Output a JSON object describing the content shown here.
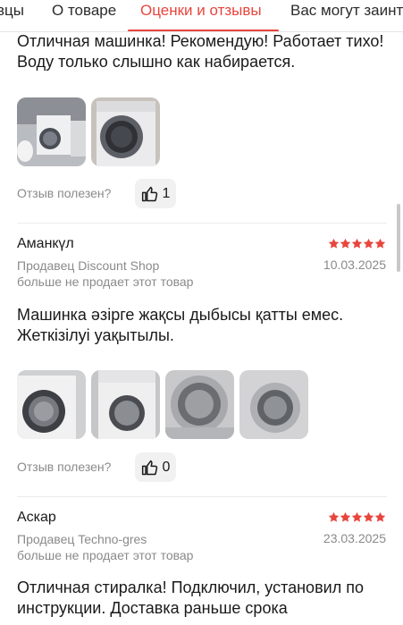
{
  "tabs": [
    {
      "label": "вцы"
    },
    {
      "label": "О товаре"
    },
    {
      "label": "Оценки и отзывы"
    },
    {
      "label": "Вас могут заинт"
    }
  ],
  "accent_color": "#e8453c",
  "star_color": "#e8453c",
  "reviews": [
    {
      "text": "Отличная машинка! Рекомендую! Работает тихо! Воду только слышно как набирается.",
      "photo_count": 2,
      "helpful_label": "Отзыв полезен?",
      "likes": "1"
    },
    {
      "author": "Аманкүл",
      "rating": 5,
      "seller": "Продавец Discount Shop",
      "seller_note": "больше не продает этот товар",
      "date": "10.03.2025",
      "text": "Машинка әзірге жақсы дыбысы қатты емес. Жеткізілуі уақытылы.",
      "photo_count": 4,
      "helpful_label": "Отзыв полезен?",
      "likes": "0"
    },
    {
      "author": "Аскар",
      "rating": 5,
      "seller": "Продавец Techno-gres",
      "seller_note": "больше не продает этот товар",
      "date": "23.03.2025",
      "text": "Отличная стиралка! Подключил, установил по инструкции. Доставка раньше срока"
    }
  ]
}
